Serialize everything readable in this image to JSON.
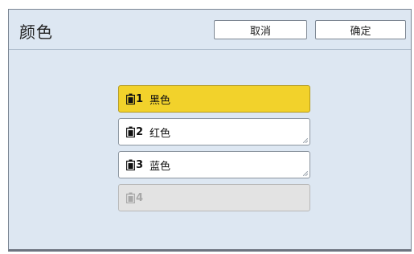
{
  "header": {
    "title": "颜色",
    "cancel_label": "取消",
    "ok_label": "确定"
  },
  "slots": [
    {
      "number": "1",
      "color_name": "黑色",
      "state": "selected",
      "icon": "ink-drum-icon"
    },
    {
      "number": "2",
      "color_name": "红色",
      "state": "normal",
      "icon": "ink-drum-icon"
    },
    {
      "number": "3",
      "color_name": "蓝色",
      "state": "normal",
      "icon": "ink-drum-icon"
    },
    {
      "number": "4",
      "color_name": "",
      "state": "disabled",
      "icon": "ink-drum-icon"
    }
  ],
  "colors": {
    "panel_bg": "#dde7f2",
    "selected": "#f2d22b",
    "disabled": "#e3e3e3"
  }
}
